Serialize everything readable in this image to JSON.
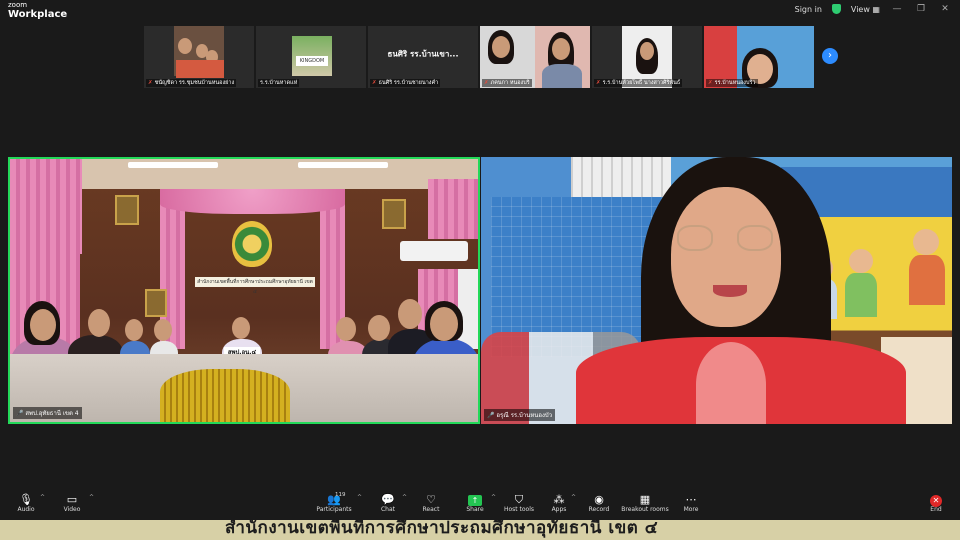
{
  "app": {
    "logo_line1": "zoom",
    "logo_line2": "Workplace",
    "sign_in": "Sign in",
    "view": "View"
  },
  "thumbnails": [
    {
      "name": "ชนัญชิดา รร.ชุมชนบ้านหนองย่าง",
      "muted": true
    },
    {
      "name": "ร.ร.บ้านหาดแห่",
      "muted": false,
      "sign": "KINGDOM"
    },
    {
      "name": "ธนศิริ รร.บ้านชายนางคำ",
      "muted": true,
      "big_text": "ธนศิริ รร.บ้านเขา..."
    },
    {
      "name": "ภคนกา หนองบริ",
      "muted": true
    },
    {
      "name": "ร.ร.บ้านห้วยโพธิ์ นางสาวศิริพันธ์",
      "muted": true
    },
    {
      "name": "รร.บ้านหนองบริว",
      "muted": true
    }
  ],
  "tiles": {
    "left_name": "สพป.อุทัยธานี เขต 4",
    "left_sign": "สพป.อน.๔",
    "left_banner": "สำนักงานเขตพื้นที่การศึกษาประถมศึกษาอุทัยธานี เขต ๔",
    "right_name": "อรุณี รร.บ้านหนองบัว"
  },
  "toolbar": {
    "audio": "Audio",
    "video": "Video",
    "participants": "Participants",
    "participant_count": "119",
    "chat": "Chat",
    "react": "React",
    "share": "Share",
    "host_tools": "Host tools",
    "apps": "Apps",
    "record": "Record",
    "breakout": "Breakout rooms",
    "more": "More",
    "end": "End"
  },
  "caption": "สำนักงานเขตพื้นที่การศึกษาประถมศึกษาอุทัยธานี เขต ๔",
  "colors": {
    "active_speaker_border": "#23d959",
    "share_green": "#23c552",
    "end_red": "#e02828",
    "next_blue": "#2d8cff"
  }
}
